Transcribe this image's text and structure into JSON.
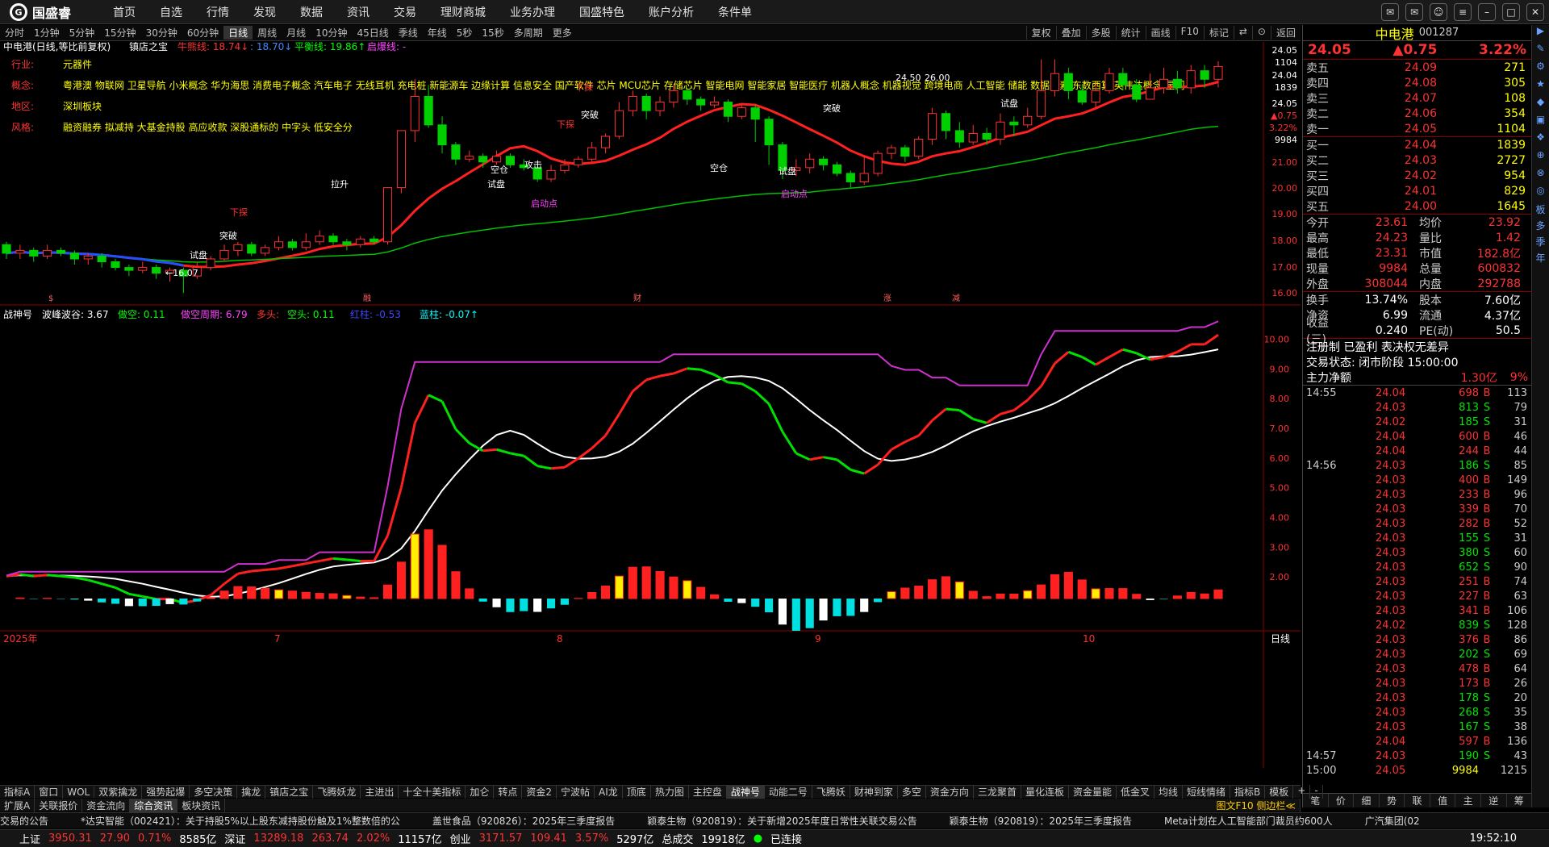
{
  "app": {
    "logo_text": "国盛睿",
    "menu": [
      "首页",
      "自选",
      "行情",
      "发现",
      "数据",
      "资讯",
      "交易",
      "理财商城",
      "业务办理",
      "国盛特色",
      "账户分析",
      "条件单"
    ]
  },
  "periods": {
    "items": [
      "分时",
      "1分钟",
      "5分钟",
      "15分钟",
      "30分钟",
      "60分钟",
      "日线",
      "周线",
      "月线",
      "10分钟",
      "45日线",
      "季线",
      "年线",
      "5秒",
      "15秒",
      "多周期",
      "更多"
    ],
    "active": "日线",
    "right": [
      "复权",
      "叠加",
      "多股",
      "统计",
      "画线",
      "F10",
      "标记",
      "⇄",
      "⊙",
      "返回"
    ]
  },
  "chart": {
    "title": "中电港(日线,等比前复权)",
    "indicator_name": "镇店之宝",
    "line1_label": "牛熊线: 18.74↓",
    "line2_label": ": 18.70↓",
    "line3_label": "平衡线: 19.86↑",
    "line4_label": "启爆线: -",
    "info": [
      {
        "k": "行业:",
        "v": "元器件"
      },
      {
        "k": "概念:",
        "v": "粤港澳 物联网 卫星导航 小米概念 华为海思 消费电子概念 汽车电子 无线耳机 充电桩 新能源车 边缘计算 信息安全 国产软件 芯片 MCU芯片 存储芯片 智能电网 智能家居 智能医疗 机器人概念 机器视觉 跨境电商 人工智能 储能 数据要素 东数西算 英伟达概念 星闪"
      },
      {
        "k": "地区:",
        "v": "深圳板块"
      },
      {
        "k": "风格:",
        "v": "融资融券 拟减持 大基金持股 高应收款 深股通标的 中字头 低安全分"
      }
    ],
    "price_axis": [
      "24.05",
      "1104",
      "24.04",
      "1839",
      "24.05",
      "▲0.75",
      "3.22%",
      "9984",
      "21.00",
      "20.00",
      "19.00",
      "18.00",
      "17.00",
      "16.00"
    ],
    "annotations": [
      "下探",
      "试盘",
      "突破",
      "空仓",
      "攻击",
      "启动点",
      "拉升",
      "下探",
      "突破",
      "试盘",
      "空仓",
      "试盘",
      "启动点",
      "突破",
      "试盘",
      "下探"
    ],
    "price_labels": [
      "16.07",
      "24.50",
      "26.00"
    ],
    "month_markers": [
      "$",
      "融",
      "财",
      "涨",
      "减"
    ],
    "lower_title": "战神号",
    "lower_legend": [
      {
        "t": "波峰波谷: 3.67",
        "c": "#ffffff"
      },
      {
        "t": "做空: 0.11",
        "c": "#00ff00"
      },
      {
        "t": "做空周期: 6.79",
        "c": "#ff44ff"
      },
      {
        "t": "多头:",
        "c": "#ff3232"
      },
      {
        "t": "空头: 0.11",
        "c": "#00ff00"
      },
      {
        "t": "红柱: -0.53",
        "c": "#4444ff"
      },
      {
        "t": "蓝柱: -0.07↑",
        "c": "#00ffff"
      }
    ],
    "lower_axis": [
      "10.00",
      "9.00",
      "8.00",
      "7.00",
      "6.00",
      "5.00",
      "4.00",
      "3.00",
      "2.00"
    ],
    "date_axis": [
      "2025年",
      "7",
      "8",
      "9",
      "10"
    ],
    "period_label": "日线"
  },
  "chart_data": {
    "type": "candlestick",
    "title": "中电港(日线,等比前复权)",
    "ylim": [
      15.8,
      24.4
    ],
    "candles": [
      [
        17.8,
        17.5,
        17.9,
        17.3
      ],
      [
        17.5,
        17.6,
        17.8,
        17.3
      ],
      [
        17.6,
        17.4,
        17.7,
        17.2
      ],
      [
        17.4,
        17.6,
        17.8,
        17.3
      ],
      [
        17.6,
        17.5,
        17.7,
        17.4
      ],
      [
        17.5,
        17.3,
        17.6,
        17.1
      ],
      [
        17.3,
        17.4,
        17.5,
        17.1
      ],
      [
        17.4,
        17.2,
        17.5,
        17.0
      ],
      [
        17.2,
        17.0,
        17.3,
        16.9
      ],
      [
        17.0,
        16.9,
        17.1,
        16.7
      ],
      [
        16.9,
        17.0,
        17.2,
        16.8
      ],
      [
        17.0,
        16.8,
        17.1,
        16.6
      ],
      [
        16.8,
        16.9,
        17.0,
        16.5
      ],
      [
        16.9,
        16.7,
        17.0,
        16.1
      ],
      [
        16.7,
        17.0,
        17.2,
        16.6
      ],
      [
        17.0,
        17.3,
        17.4,
        16.9
      ],
      [
        17.3,
        17.6,
        17.8,
        17.2
      ],
      [
        17.6,
        17.8,
        17.9,
        17.4
      ],
      [
        17.8,
        17.5,
        17.9,
        17.4
      ],
      [
        17.5,
        17.7,
        17.8,
        17.4
      ],
      [
        17.7,
        17.9,
        18.1,
        17.6
      ],
      [
        17.9,
        17.7,
        18.0,
        17.6
      ],
      [
        17.7,
        17.9,
        18.2,
        17.6
      ],
      [
        17.9,
        18.1,
        18.3,
        17.8
      ],
      [
        18.1,
        17.9,
        18.2,
        17.8
      ],
      [
        17.9,
        17.8,
        18.0,
        17.6
      ],
      [
        17.8,
        18.0,
        18.1,
        17.7
      ],
      [
        18.0,
        17.9,
        18.1,
        17.8
      ],
      [
        17.9,
        19.8,
        19.8,
        17.8
      ],
      [
        19.8,
        21.8,
        21.8,
        19.6
      ],
      [
        21.8,
        23.0,
        23.6,
        21.4
      ],
      [
        23.0,
        22.0,
        23.4,
        21.9
      ],
      [
        22.0,
        21.3,
        22.3,
        21.0
      ],
      [
        21.3,
        20.8,
        21.4,
        20.6
      ],
      [
        20.8,
        20.9,
        21.1,
        20.7
      ],
      [
        20.9,
        20.7,
        21.0,
        20.5
      ],
      [
        20.7,
        20.9,
        21.1,
        20.6
      ],
      [
        20.9,
        20.6,
        21.0,
        20.5
      ],
      [
        20.6,
        20.5,
        20.8,
        20.4
      ],
      [
        20.5,
        20.1,
        20.6,
        20.0
      ],
      [
        20.1,
        20.4,
        20.6,
        20.0
      ],
      [
        20.4,
        20.6,
        20.8,
        20.3
      ],
      [
        20.6,
        20.8,
        20.9,
        20.5
      ],
      [
        20.8,
        21.2,
        21.4,
        20.7
      ],
      [
        21.2,
        21.6,
        21.7,
        21.0
      ],
      [
        21.6,
        22.5,
        22.8,
        21.5
      ],
      [
        22.5,
        23.0,
        23.2,
        22.3
      ],
      [
        23.0,
        22.5,
        23.1,
        22.2
      ],
      [
        22.5,
        22.8,
        23.0,
        22.3
      ],
      [
        22.8,
        23.2,
        23.4,
        22.6
      ],
      [
        23.2,
        22.9,
        23.3,
        22.7
      ],
      [
        22.9,
        22.7,
        23.0,
        22.5
      ],
      [
        22.7,
        22.8,
        23.0,
        22.6
      ],
      [
        22.8,
        22.3,
        22.9,
        22.1
      ],
      [
        22.3,
        22.6,
        22.7,
        22.2
      ],
      [
        22.6,
        22.2,
        22.7,
        21.4
      ],
      [
        22.2,
        21.3,
        22.3,
        20.6
      ],
      [
        21.3,
        20.4,
        21.4,
        20.1
      ],
      [
        20.4,
        20.5,
        20.8,
        20.2
      ],
      [
        20.5,
        20.8,
        21.0,
        20.3
      ],
      [
        20.8,
        20.6,
        20.9,
        20.4
      ],
      [
        20.6,
        20.3,
        20.7,
        20.2
      ],
      [
        20.3,
        20.0,
        20.4,
        19.8
      ],
      [
        20.0,
        20.3,
        20.9,
        19.9
      ],
      [
        20.3,
        21.0,
        21.1,
        20.2
      ],
      [
        21.0,
        21.2,
        21.3,
        20.8
      ],
      [
        21.2,
        20.9,
        21.3,
        20.7
      ],
      [
        20.9,
        21.5,
        21.6,
        20.8
      ],
      [
        21.5,
        22.4,
        22.6,
        21.3
      ],
      [
        22.4,
        21.8,
        22.5,
        21.5
      ],
      [
        21.8,
        21.4,
        22.1,
        21.2
      ],
      [
        21.4,
        21.7,
        22.0,
        21.3
      ],
      [
        21.7,
        21.5,
        21.9,
        21.3
      ],
      [
        21.5,
        22.1,
        22.4,
        21.3
      ],
      [
        22.1,
        22.0,
        22.3,
        21.6
      ],
      [
        22.0,
        22.3,
        22.6,
        21.9
      ],
      [
        22.3,
        23.2,
        24.3,
        22.2
      ],
      [
        23.2,
        23.8,
        24.3,
        23.0
      ],
      [
        23.8,
        23.2,
        24.0,
        22.9
      ],
      [
        23.2,
        22.8,
        23.4,
        22.7
      ],
      [
        22.8,
        23.2,
        23.5,
        22.6
      ],
      [
        23.2,
        23.8,
        24.0,
        23.1
      ],
      [
        23.8,
        23.4,
        24.0,
        23.2
      ],
      [
        23.4,
        22.9,
        23.6,
        22.8
      ],
      [
        22.9,
        23.3,
        23.8,
        22.9
      ],
      [
        23.3,
        23.6,
        24.0,
        23.1
      ],
      [
        23.6,
        23.3,
        23.9,
        23.1
      ],
      [
        23.3,
        23.9,
        24.1,
        23.1
      ],
      [
        23.9,
        23.6,
        24.1,
        23.3
      ],
      [
        23.6,
        24.05,
        24.23,
        23.31
      ]
    ]
  },
  "quote": {
    "name": "中电港",
    "code": "001287",
    "price": "24.05",
    "change": "▲0.75",
    "pct": "3.22%",
    "sells": [
      {
        "l": "卖五",
        "p": "24.09",
        "v": "271"
      },
      {
        "l": "卖四",
        "p": "24.08",
        "v": "305"
      },
      {
        "l": "卖三",
        "p": "24.07",
        "v": "108"
      },
      {
        "l": "卖二",
        "p": "24.06",
        "v": "354"
      },
      {
        "l": "卖一",
        "p": "24.05",
        "v": "1104"
      }
    ],
    "buys": [
      {
        "l": "买一",
        "p": "24.04",
        "v": "1839"
      },
      {
        "l": "买二",
        "p": "24.03",
        "v": "2727"
      },
      {
        "l": "买三",
        "p": "24.02",
        "v": "954"
      },
      {
        "l": "买四",
        "p": "24.01",
        "v": "829"
      },
      {
        "l": "买五",
        "p": "24.00",
        "v": "1645"
      }
    ],
    "stats": [
      {
        "a": "今开",
        "b": "23.61",
        "c": "均价",
        "d": "23.92"
      },
      {
        "a": "最高",
        "b": "24.23",
        "c": "量比",
        "d": "1.42"
      },
      {
        "a": "最低",
        "b": "23.31",
        "c": "市值",
        "d": "182.8亿"
      },
      {
        "a": "现量",
        "b": "9984",
        "c": "总量",
        "d": "600832"
      },
      {
        "a": "外盘",
        "b": "308044",
        "c": "内盘",
        "d": "292788"
      }
    ],
    "stats2": [
      {
        "a": "换手",
        "b": "13.74%",
        "c": "股本",
        "d": "7.60亿"
      },
      {
        "a": "净资",
        "b": "6.99",
        "c": "流通",
        "d": "4.37亿"
      },
      {
        "a": "收益(三)",
        "b": "0.240",
        "c": "PE(动)",
        "d": "50.5"
      }
    ],
    "tags": "注册制 已盈利 表决权无差异",
    "trade_state": "交易状态: 闭市阶段 15:00:00",
    "main_flow_label": "主力净额",
    "main_flow_value": "1.30亿",
    "main_flow_pct": "9%",
    "ticks": [
      [
        "14:55",
        "24.04",
        "698",
        "B",
        "113"
      ],
      [
        "",
        "24.03",
        "813",
        "S",
        "79"
      ],
      [
        "",
        "24.02",
        "185",
        "S",
        "31"
      ],
      [
        "",
        "24.04",
        "600",
        "B",
        "46"
      ],
      [
        "",
        "24.04",
        "244",
        "B",
        "44"
      ],
      [
        "14:56",
        "24.03",
        "186",
        "S",
        "85"
      ],
      [
        "",
        "24.03",
        "400",
        "B",
        "149"
      ],
      [
        "",
        "24.03",
        "233",
        "B",
        "96"
      ],
      [
        "",
        "24.03",
        "339",
        "B",
        "70"
      ],
      [
        "",
        "24.03",
        "282",
        "B",
        "52"
      ],
      [
        "",
        "24.03",
        "155",
        "S",
        "31"
      ],
      [
        "",
        "24.03",
        "380",
        "S",
        "60"
      ],
      [
        "",
        "24.03",
        "652",
        "S",
        "90"
      ],
      [
        "",
        "24.03",
        "251",
        "B",
        "74"
      ],
      [
        "",
        "24.03",
        "227",
        "B",
        "63"
      ],
      [
        "",
        "24.03",
        "341",
        "B",
        "106"
      ],
      [
        "",
        "24.02",
        "839",
        "S",
        "128"
      ],
      [
        "",
        "24.03",
        "376",
        "B",
        "86"
      ],
      [
        "",
        "24.03",
        "202",
        "S",
        "69"
      ],
      [
        "",
        "24.03",
        "478",
        "B",
        "64"
      ],
      [
        "",
        "24.03",
        "173",
        "B",
        "26"
      ],
      [
        "",
        "24.03",
        "178",
        "S",
        "20"
      ],
      [
        "",
        "24.03",
        "268",
        "S",
        "35"
      ],
      [
        "",
        "24.03",
        "167",
        "S",
        "38"
      ],
      [
        "",
        "24.04",
        "597",
        "B",
        "136"
      ],
      [
        "14:57",
        "24.03",
        "190",
        "S",
        "43"
      ],
      [
        "15:00",
        "24.05",
        "9984",
        "",
        "1215"
      ]
    ],
    "tabs": [
      "笔",
      "价",
      "细",
      "势",
      "联",
      "值",
      "主",
      "逆",
      "筹"
    ]
  },
  "sidestrip": [
    "板",
    "多",
    "季",
    "年"
  ],
  "bottom_tabs1": [
    "指标A",
    "窗口",
    "WOL",
    "双紫擒龙",
    "强势起爆",
    "多空决策",
    "擒龙",
    "镇店之宝",
    "飞腾妖龙",
    "主进出",
    "十全十美指标",
    "加仑",
    "转点",
    "资金2",
    "宁波帖",
    "AI龙",
    "顶底",
    "热力图",
    "主控盘",
    "战神号",
    "动能二号",
    "飞腾妖",
    "财神到家",
    "多空",
    "资金方向",
    "三龙聚首",
    "量化连板",
    "资金量能",
    "低金叉",
    "均线",
    "短线情绪"
  ],
  "bottom_tabs1_right": [
    "指标B",
    "模板",
    "+",
    "-"
  ],
  "bottom_tabs2": [
    "扩展A",
    "关联报价",
    "资金流向",
    "综合资讯",
    "板块资讯"
  ],
  "bottom_tabs2_right": "图文F10 侧边栏≪",
  "news": [
    "交易的公告",
    "*达实智能（002421）：关于持股5%以上股东减持股份触及1%整数倍的公",
    "盖世食品（920826）：2025年三季度报告",
    "颖泰生物（920819）：关于新增2025年度日常性关联交易公告",
    "颖泰生物（920819）：2025年三季度报告",
    "Meta计划在人工智能部门裁员约600人",
    "广汽集团(02"
  ],
  "status": {
    "sh": "上证",
    "sh_v": "3950.31",
    "sh_c": "27.90",
    "sh_p": "0.71%",
    "sh_a": "8585亿",
    "sz": "深证",
    "sz_v": "13289.18",
    "sz_c": "263.74",
    "sz_p": "2.02%",
    "sz_a": "11157亿",
    "cy": "创业",
    "cy_v": "3171.57",
    "cy_c": "109.41",
    "cy_p": "3.57%",
    "cy_a": "5297亿",
    "total": "总成交",
    "total_v": "19918亿",
    "conn": "已连接",
    "time": "19:52:10"
  }
}
